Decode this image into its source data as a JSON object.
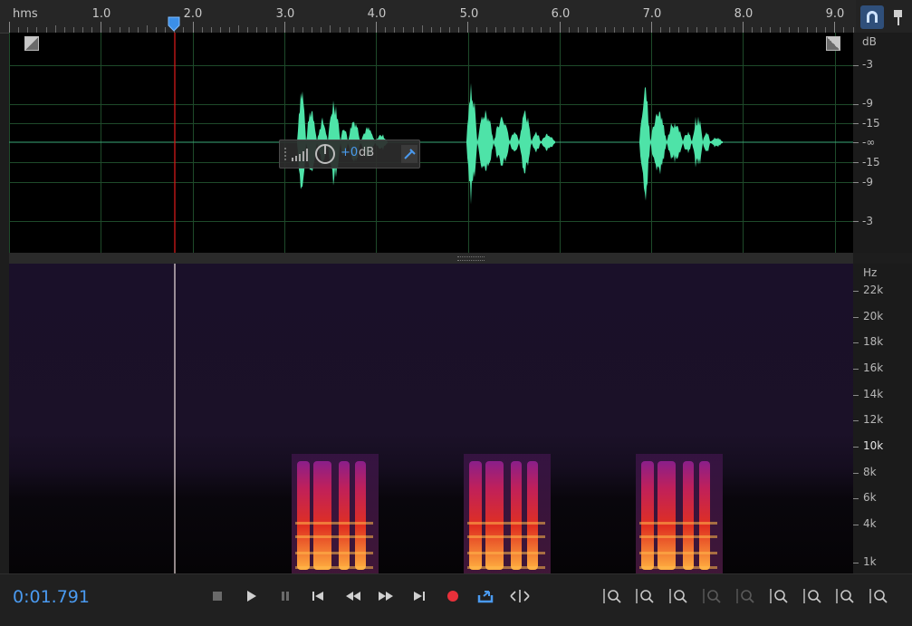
{
  "ruler": {
    "unit": "hms",
    "ticks": [
      "1.0",
      "2.0",
      "3.0",
      "4.0",
      "5.0",
      "6.0",
      "7.0",
      "8.0",
      "9.0"
    ]
  },
  "playhead": {
    "time_seconds": 1.791
  },
  "timecode": "0:01.791",
  "db_scale": {
    "unit": "dB",
    "labels": [
      "-3",
      "-9",
      "-15",
      "-∞",
      "-15",
      "-9",
      "-3"
    ]
  },
  "hz_scale": {
    "unit": "Hz",
    "labels": [
      "22k",
      "20k",
      "18k",
      "16k",
      "14k",
      "12k",
      "10k",
      "8k",
      "6k",
      "4k",
      "1k"
    ]
  },
  "hud": {
    "gain_value": "+0",
    "gain_unit": "dB"
  },
  "colors": {
    "waveform": "#4ee3a8",
    "accent": "#4a9af0",
    "record": "#e8303a",
    "playhead": "#d01818"
  },
  "transport": {
    "buttons": [
      "stop-icon",
      "play-icon",
      "pause-icon",
      "go-to-start-icon",
      "rewind-icon",
      "fast-forward-icon",
      "go-to-end-icon",
      "record-icon",
      "loop-icon",
      "skip-selection-icon"
    ]
  },
  "zoom_tools": [
    "zoom-in-amplitude-icon",
    "zoom-out-amplitude-icon",
    "zoom-in-time-icon",
    "zoom-out-full-icon",
    "zoom-selection-icon",
    "zoom-in-left-icon",
    "zoom-in-right-icon",
    "zoom-out-both-icon",
    "zoom-reset-icon"
  ]
}
